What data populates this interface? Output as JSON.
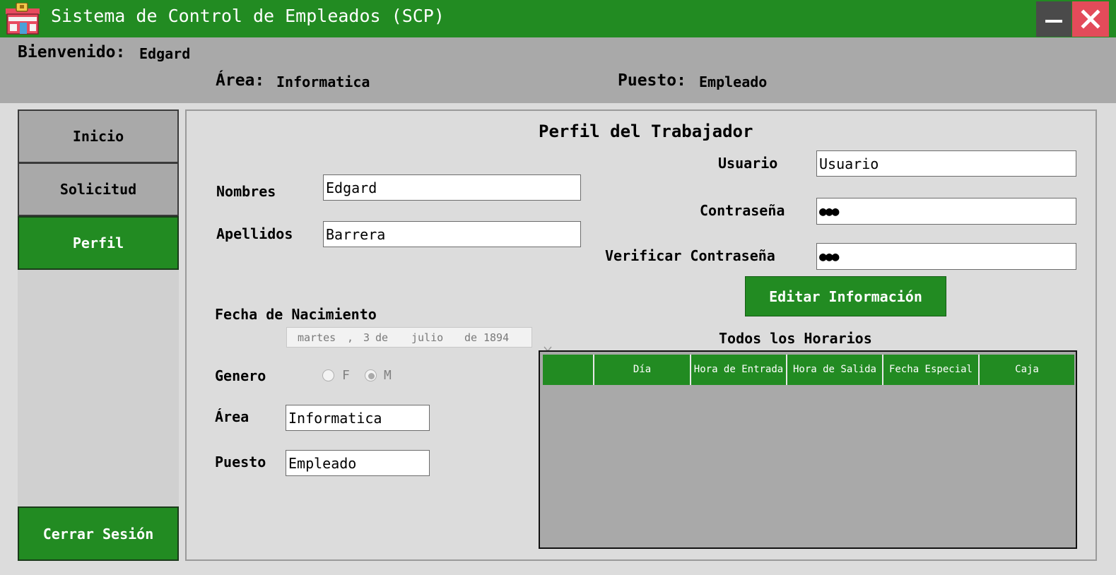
{
  "window": {
    "title": "Sistema de Control de Empleados (SCP)",
    "minimize_icon": "minimize-icon",
    "close_icon": "close-icon",
    "accent_color": "#228b22"
  },
  "header": {
    "welcome_label": "Bienvenido:",
    "welcome_value": "Edgard",
    "area_label": "Área:",
    "area_value": "Informatica",
    "position_label": "Puesto:",
    "position_value": "Empleado"
  },
  "sidebar": {
    "items": [
      {
        "label": "Inicio",
        "active": false
      },
      {
        "label": "Solicitud",
        "active": false
      },
      {
        "label": "Perfil",
        "active": true
      }
    ],
    "logout_label": "Cerrar Sesión"
  },
  "profile": {
    "title": "Perfil del Trabajador",
    "nombres_label": "Nombres",
    "nombres_value": "Edgard",
    "apellidos_label": "Apellidos",
    "apellidos_value": "Barrera",
    "birth_label": "Fecha de Nacimiento",
    "birth_date": {
      "weekday": "martes",
      "sep": ",",
      "day": "3",
      "de1": "de",
      "month": "julio",
      "de2": "de",
      "year": "1894"
    },
    "gender_label": "Genero",
    "gender_options": [
      "F",
      "M"
    ],
    "gender_selected": "M",
    "area_label": "Área",
    "area_value": "Informatica",
    "puesto_label": "Puesto",
    "puesto_value": "Empleado",
    "usuario_label": "Usuario",
    "usuario_value": "Usuario",
    "password_label": "Contraseña",
    "password_value": "●●●",
    "verify_label": "Verificar Contraseña",
    "verify_value": "●●●",
    "edit_button": "Editar Información"
  },
  "schedules": {
    "title": "Todos los Horarios",
    "columns": [
      "",
      "Día",
      "Hora de Entrada",
      "Hora de Salida",
      "Fecha Especial",
      "Caja"
    ],
    "rows": []
  }
}
